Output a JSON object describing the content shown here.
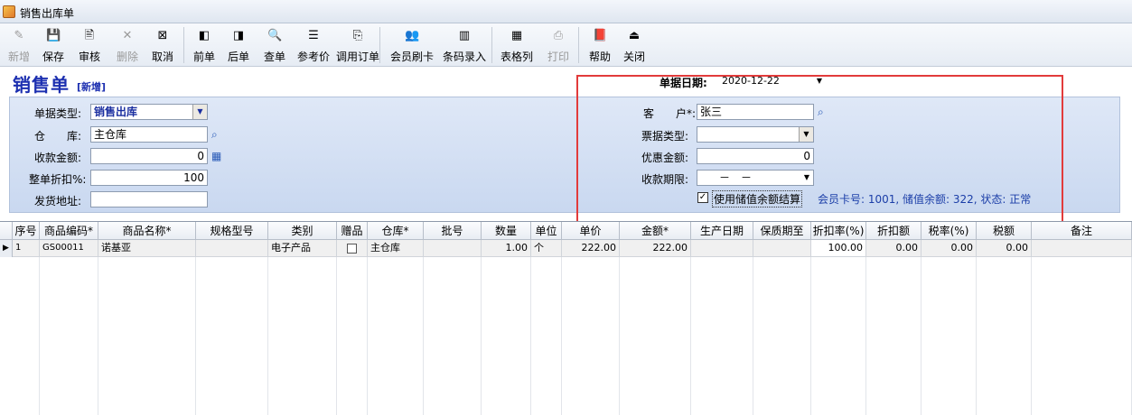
{
  "window": {
    "title": "销售出库单"
  },
  "toolbar": {
    "buttons": [
      {
        "label": "新增",
        "icon": "new-icon",
        "glyph": "✎",
        "disabled": true
      },
      {
        "label": "保存",
        "icon": "save-icon",
        "glyph": "💾",
        "disabled": false
      },
      {
        "label": "审核",
        "icon": "audit-icon",
        "glyph": "🖹",
        "disabled": false
      },
      {
        "label": "删除",
        "icon": "delete-icon",
        "glyph": "✕",
        "disabled": true
      },
      {
        "label": "取消",
        "icon": "cancel-icon",
        "glyph": "⊠",
        "disabled": false
      },
      {
        "label": "前单",
        "icon": "previous-doc-icon",
        "glyph": "◧",
        "disabled": false
      },
      {
        "label": "后单",
        "icon": "next-doc-icon",
        "glyph": "◨",
        "disabled": false
      },
      {
        "label": "查单",
        "icon": "search-doc-icon",
        "glyph": "🔍",
        "disabled": false
      },
      {
        "label": "参考价",
        "icon": "reference-price-icon",
        "glyph": "☰",
        "disabled": false
      },
      {
        "label": "调用订单",
        "icon": "load-order-icon",
        "glyph": "⎘",
        "disabled": false
      },
      {
        "label": "会员刷卡",
        "icon": "member-card-icon",
        "glyph": "👥",
        "disabled": false
      },
      {
        "label": "条码录入",
        "icon": "barcode-icon",
        "glyph": "▥",
        "disabled": false
      },
      {
        "label": "表格列",
        "icon": "table-columns-icon",
        "glyph": "▦",
        "disabled": false
      },
      {
        "label": "打印",
        "icon": "print-icon",
        "glyph": "⎙",
        "disabled": true
      },
      {
        "label": "帮助",
        "icon": "help-icon",
        "glyph": "📕",
        "disabled": false
      },
      {
        "label": "关闭",
        "icon": "close-icon",
        "glyph": "⏏",
        "disabled": false
      }
    ]
  },
  "header": {
    "title": "销售单",
    "mode_tag": "[新增]"
  },
  "form": {
    "doc_date_label": "单据日期:",
    "doc_date": "2020-12-22",
    "doc_type_label": "单据类型:",
    "doc_type": "销售出库",
    "warehouse_label": "仓　　库:",
    "warehouse": "主仓库",
    "received_label": "收款金额:",
    "received": "0",
    "discount_label": "整单折扣%:",
    "discount": "100",
    "address_label": "发货地址:",
    "address": "",
    "customer_label": "客　　户*:",
    "customer": "张三",
    "invoice_type_label": "票据类型:",
    "invoice_type": "",
    "promo_label": "优惠金额:",
    "promo": "0",
    "due_label": "收款期限:",
    "due": "－　－",
    "use_balance_label": "使用储值余额结算",
    "use_balance_checked": true,
    "member_info": "会员卡号: 1001, 储值余额: 322, 状态: 正常"
  },
  "grid": {
    "columns": [
      "序号",
      "商品编码*",
      "商品名称*",
      "规格型号",
      "类别",
      "赠品",
      "仓库*",
      "批号",
      "数量",
      "单位",
      "单价",
      "金额*",
      "生产日期",
      "保质期至",
      "折扣率(%)",
      "折扣额",
      "税率(%)",
      "税额",
      "备注"
    ],
    "rows": [
      [
        "1",
        "GS00011",
        "诺基亚",
        "",
        "电子产品",
        "",
        "主仓库",
        "",
        "1.00",
        "个",
        "222.00",
        "222.00",
        "",
        "",
        "100.00",
        "0.00",
        "0.00",
        "0.00",
        ""
      ]
    ]
  }
}
